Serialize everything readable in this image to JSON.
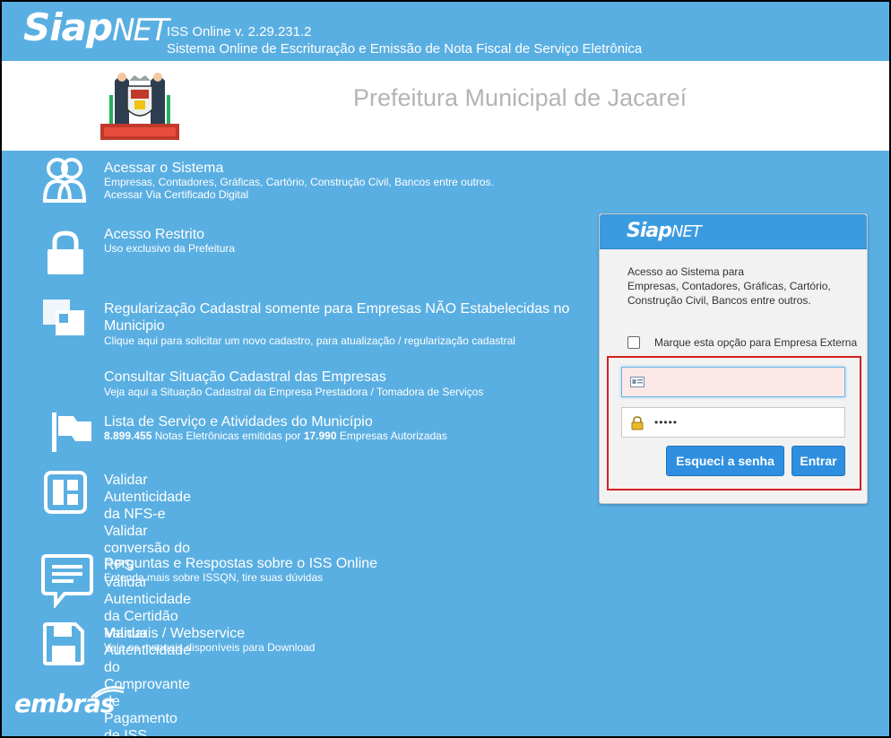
{
  "header": {
    "logo": {
      "siap": "Siap",
      "net": "NET"
    },
    "version": "ISS Online v. 2.29.231.2",
    "description": "Sistema Online de Escrituração e Emissão de Nota Fiscal de Serviço Eletrônica"
  },
  "banner": {
    "title": "Prefeitura Municipal de Jacareí",
    "crest_icon": "city-crest-icon"
  },
  "menu": [
    {
      "icon": "users-icon",
      "title": "Acessar o Sistema",
      "subtitle": "Empresas, Contadores, Gráficas, Cartório, Construção Civil, Bancos entre outros.",
      "subtitle2": "Acessar Via Certificado Digital"
    },
    {
      "icon": "lock-icon",
      "title": "Acesso Restrito",
      "subtitle": "Uso exclusivo da Prefeitura"
    },
    {
      "icon": "squares-icon",
      "title": "Regularização Cadastral somente para Empresas NÃO Estabelecidas no",
      "title2": "Municipio",
      "subtitle": "Clique aqui para solicitar um novo cadastro, para atualização / regularização cadastral"
    },
    {
      "title": "Consultar Situação Cadastral das Empresas",
      "subtitle": "Veja aqui a Situação Cadastral da Empresa Prestadora / Tomadora de Serviços"
    },
    {
      "icon": "flag-icon",
      "title": "Lista de Serviço e Atividades do Município",
      "stats": {
        "notes": "8.899.455",
        "notes_text": "Notas Eletrônicas emitidas por",
        "companies": "17.990",
        "companies_text": "Empresas Autorizadas"
      }
    },
    {
      "icon": "layout-icon",
      "links": [
        "Validar Autenticidade da NFS-e",
        "Validar conversão do RPS",
        "Validar Autenticidade da Certidão",
        "Validar Autenticidade do Comprovante de Pagamento de ISS Retido"
      ]
    },
    {
      "icon": "chat-icon",
      "title": "Perguntas e Respostas sobre o ISS Online",
      "subtitle": "Entenda mais sobre ISSQN, tire suas dúvidas"
    },
    {
      "icon": "floppy-icon",
      "title": "Manuais / Webservice",
      "subtitle": "Veja os manuais disponíveis para Download"
    }
  ],
  "login": {
    "logo": {
      "siap": "Siap",
      "net": "NET"
    },
    "intro_line1": "Acesso ao Sistema para",
    "intro_line2": "Empresas, Contadores, Gráficas, Cartório,",
    "intro_line3": "Construção Civil, Bancos entre outros.",
    "external_label": "Marque esta opção para Empresa Externa",
    "username_value": "",
    "password_value": "•••••",
    "forgot_label": "Esqueci a senha",
    "enter_label": "Entrar"
  },
  "footer": {
    "brand": "embras"
  },
  "colors": {
    "background": "#5aafe2",
    "panel_header": "#3b9be0",
    "button": "#2e8fe0",
    "highlight_border": "#d42020"
  }
}
